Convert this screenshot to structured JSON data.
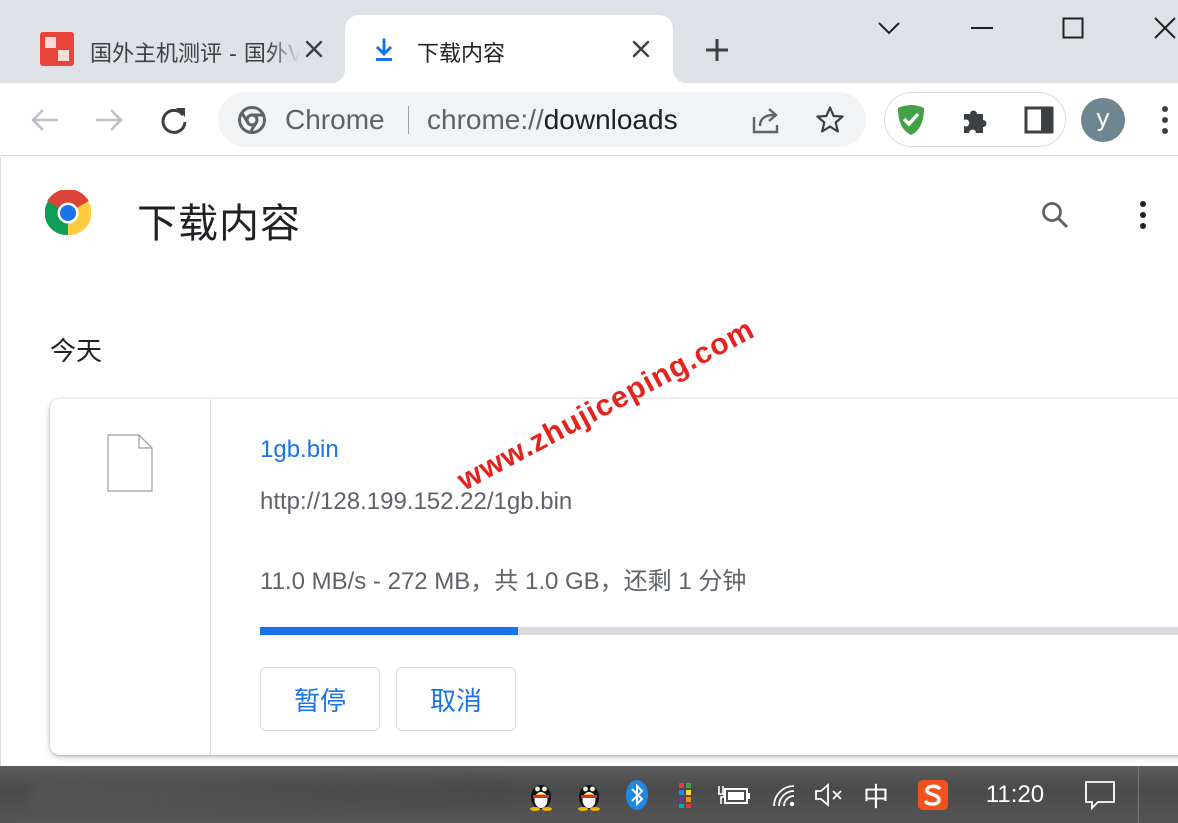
{
  "tabs": [
    {
      "title": "国外主机测评 - 国外VPS，",
      "close_icon": "close-icon"
    },
    {
      "title": "下载内容",
      "close_icon": "close-icon",
      "active": true
    }
  ],
  "toolbar": {
    "omnibox_chip": "Chrome",
    "url_scheme": "chrome://",
    "url_host": "downloads",
    "avatar_letter": "y"
  },
  "page": {
    "title": "下载内容",
    "date_heading": "今天"
  },
  "download": {
    "file_name": "1gb.bin",
    "url": "http://128.199.152.22/1gb.bin",
    "status": "11.0 MB/s - 272 MB，共 1.0 GB，还剩 1 分钟",
    "progress": 0.272,
    "pause_label": "暂停",
    "cancel_label": "取消"
  },
  "watermark": "www.zhujiceping.com",
  "taskbar": {
    "ime": "中",
    "clock": "11:20"
  },
  "colors": {
    "accent": "#1a73e8",
    "tabstrip": "#dee1e6",
    "watermark": "#e4231e",
    "adguard": "#43a047"
  }
}
